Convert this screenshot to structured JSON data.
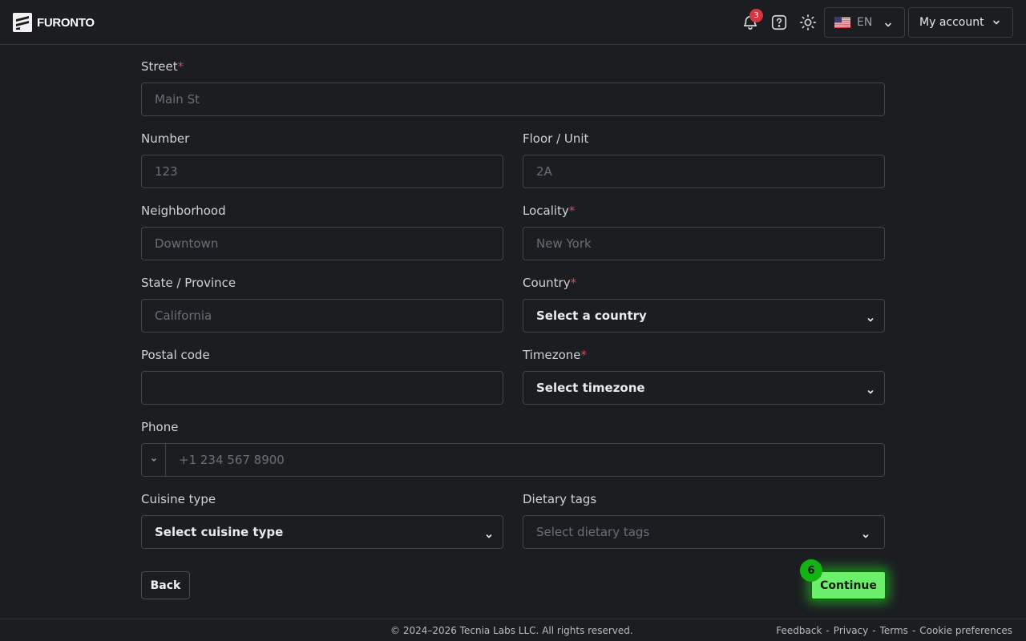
{
  "header": {
    "logo_text": "FURONTO",
    "notification_count": "3",
    "language_code": "EN",
    "account_label": "My account"
  },
  "form": {
    "street": {
      "label": "Street",
      "required": "*",
      "placeholder": "Main St"
    },
    "number": {
      "label": "Number",
      "placeholder": "123"
    },
    "floor": {
      "label": "Floor / Unit",
      "placeholder": "2A"
    },
    "neighborhood": {
      "label": "Neighborhood",
      "placeholder": "Downtown"
    },
    "locality": {
      "label": "Locality",
      "required": "*",
      "placeholder": "New York"
    },
    "state": {
      "label": "State / Province",
      "placeholder": "California"
    },
    "country": {
      "label": "Country",
      "required": "*",
      "value": "Select a country"
    },
    "postal": {
      "label": "Postal code",
      "placeholder": ""
    },
    "timezone": {
      "label": "Timezone",
      "required": "*",
      "value": "Select timezone"
    },
    "phone": {
      "label": "Phone",
      "placeholder": "+1 234 567 8900"
    },
    "cuisine": {
      "label": "Cuisine type",
      "value": "Select cuisine type"
    },
    "dietary": {
      "label": "Dietary tags",
      "placeholder": "Select dietary tags"
    }
  },
  "actions": {
    "back_label": "Back",
    "continue_label": "Continue",
    "step_number": "6"
  },
  "footer": {
    "copyright": "© 2024–2026 Tecnia Labs LLC. All rights reserved.",
    "links": [
      "Feedback",
      "Privacy",
      "Terms",
      "Cookie preferences"
    ],
    "separator": "-"
  },
  "colors": {
    "background": "#1b1d21",
    "required": "#e0454f",
    "badge": "#d9343f",
    "continue": "#6cf06c"
  }
}
